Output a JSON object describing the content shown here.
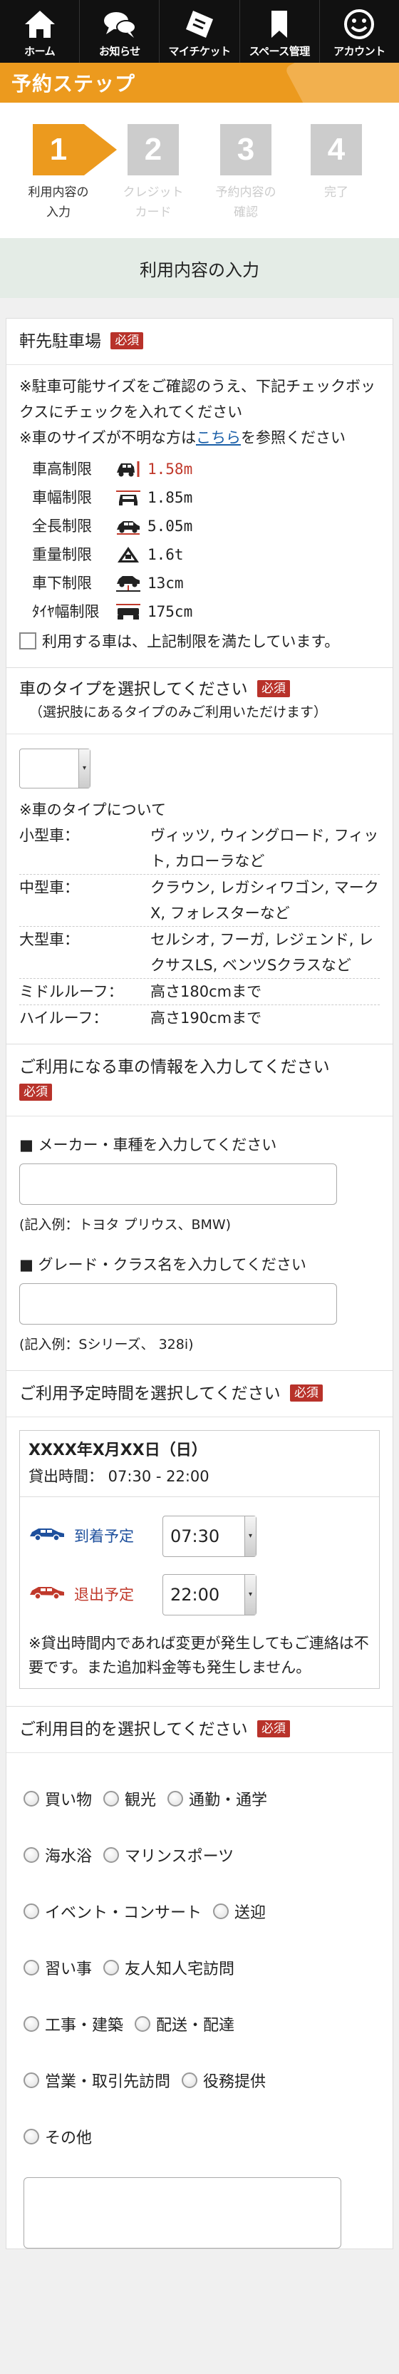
{
  "nav": {
    "items": [
      {
        "label": "ホーム",
        "icon": "home-icon"
      },
      {
        "label": "お知らせ",
        "icon": "chat-bubbles-icon"
      },
      {
        "label": "マイチケット",
        "icon": "ticket-icon"
      },
      {
        "label": "スペース管理",
        "icon": "bookmark-icon"
      },
      {
        "label": "アカウント",
        "icon": "smiley-icon"
      }
    ]
  },
  "header": {
    "title": "予約ステップ"
  },
  "steps": [
    {
      "number": "1",
      "line1": "利用内容の",
      "line2": "入力",
      "active": true
    },
    {
      "number": "2",
      "line1": "クレジット",
      "line2": "カード",
      "active": false
    },
    {
      "number": "3",
      "line1": "予約内容の",
      "line2": "確認",
      "active": false
    },
    {
      "number": "4",
      "line1": "完了",
      "line2": "",
      "active": false
    }
  ],
  "band": {
    "title": "利用内容の入力"
  },
  "required_label": "必須",
  "parking": {
    "title": "軒先駐車場",
    "instruction": "※駐車可能サイズをご確認のうえ、下記チェックボックスにチェックを入れてください",
    "size_note_prefix": "※車のサイズが不明な方は",
    "size_note_link": "こちら",
    "size_note_suffix": "を参照ください",
    "limits": [
      {
        "label": "車高制限",
        "value": "1.58m",
        "icon": "car-height-icon",
        "highlight": true
      },
      {
        "label": "車幅制限",
        "value": "1.85m",
        "icon": "car-width-icon",
        "highlight": false
      },
      {
        "label": "全長制限",
        "value": "5.05m",
        "icon": "car-length-icon",
        "highlight": false
      },
      {
        "label": "重量制限",
        "value": "1.6t",
        "icon": "weight-icon",
        "highlight": false
      },
      {
        "label": "車下制限",
        "value": "13cm",
        "icon": "ground-clearance-icon",
        "highlight": false
      },
      {
        "label": "ﾀｲﾔ幅制限",
        "value": "175cm",
        "icon": "tire-width-icon",
        "highlight": false
      }
    ],
    "confirm_label": "利用する車は、上記制限を満たしています。"
  },
  "car_type": {
    "title": "車のタイプを選択してください",
    "subtitle": "（選択肢にあるタイプのみご利用いただけます）",
    "about": "※車のタイプについて",
    "types": [
      {
        "type": "小型車：",
        "examples": "ヴィッツ, ウィングロード, フィット, カローラなど"
      },
      {
        "type": "中型車：",
        "examples": "クラウン, レガシィワゴン, マークX, フォレスターなど"
      },
      {
        "type": "大型車：",
        "examples": "セルシオ, フーガ, レジェンド, レクサスLS, ベンツSクラスなど"
      },
      {
        "type": "ミドルルーフ：",
        "examples": "高さ180cmまで"
      },
      {
        "type": "ハイルーフ：",
        "examples": "高さ190cmまで"
      }
    ]
  },
  "car_info": {
    "title": "ご利用になる車の情報を入力してください",
    "maker_label": "■ メーカー・車種を入力してください",
    "maker_example": "(記入例：トヨタ プリウス、BMW)",
    "grade_label": "■ グレード・クラス名を入力してください",
    "grade_example": "(記入例：Sシリーズ、 328i)"
  },
  "schedule": {
    "title": "ご利用予定時間を選択してください",
    "date": "XXXX年X月XX日（日）",
    "lending_time": "貸出時間：  07:30 - 22:00",
    "arrival_label": "到着予定",
    "arrival_value": "07:30",
    "departure_label": "退出予定",
    "departure_value": "22:00",
    "note": "※貸出時間内であれば変更が発生してもご連絡は不要です。また追加料金等も発生しません。"
  },
  "purpose": {
    "title": "ご利用目的を選択してください",
    "options": [
      [
        "買い物",
        "観光",
        "通勤・通学"
      ],
      [
        "海水浴",
        "マリンスポーツ"
      ],
      [
        "イベント・コンサート",
        "送迎"
      ],
      [
        "習い事",
        "友人知人宅訪問"
      ],
      [
        "工事・建築",
        "配送・配達"
      ],
      [
        "営業・取引先訪問",
        "役務提供"
      ],
      [
        "その他"
      ]
    ]
  }
}
